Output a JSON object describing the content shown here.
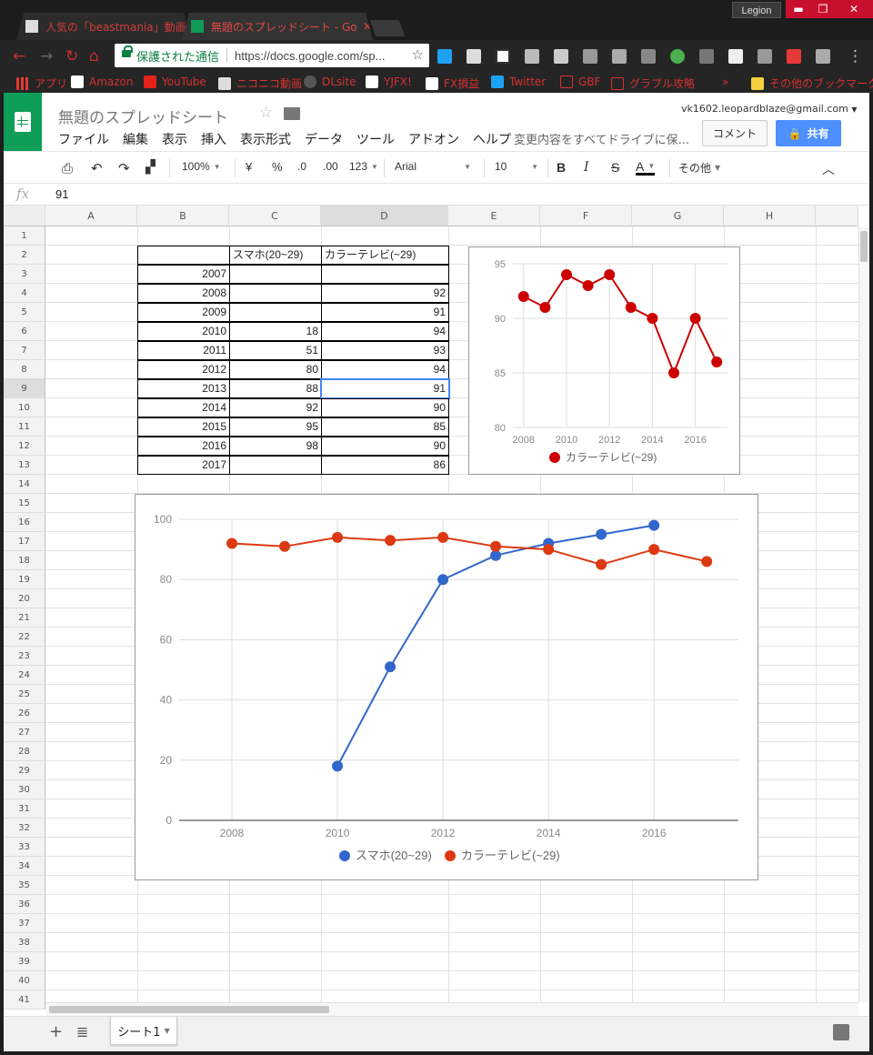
{
  "browser": {
    "profile": "Legion",
    "tabs": [
      {
        "label": "人気の「beastmania」動画",
        "close": "×"
      },
      {
        "label": "無題のスプレッドシート - Go",
        "close": "×"
      }
    ],
    "address": {
      "secure_label": "保護された通信",
      "url": "https://docs.google.com/sp..."
    },
    "bookmarks": [
      {
        "label": "アプリ"
      },
      {
        "label": "Amazon"
      },
      {
        "label": "YouTube"
      },
      {
        "label": "ニコニコ動画"
      },
      {
        "label": "DLsite"
      },
      {
        "label": "YJFX!"
      },
      {
        "label": "FX損益"
      },
      {
        "label": "Twitter"
      },
      {
        "label": "GBF"
      },
      {
        "label": "グラブル攻略"
      },
      {
        "label": "»"
      },
      {
        "label": "その他のブックマーク"
      }
    ]
  },
  "app": {
    "title": "無題のスプレッドシート",
    "account": "vk1602.leopardblaze@gmail.com",
    "menu": [
      "ファイル",
      "編集",
      "表示",
      "挿入",
      "表示形式",
      "データ",
      "ツール",
      "アドオン",
      "ヘルプ"
    ],
    "save_status": "変更内容をすべてドライブに保...",
    "comment_label": "コメント",
    "share_label": "共有"
  },
  "toolbar": {
    "zoom": "100%",
    "currency": "¥",
    "percent": "%",
    "dec_less": ".0",
    "dec_more": ".00",
    "format_more": "123",
    "font": "Arial",
    "font_size": "10",
    "bold": "B",
    "italic": "I",
    "strike": "S",
    "text_color": "A",
    "more": "その他"
  },
  "formula": {
    "fx": "fx",
    "value": "91"
  },
  "columns": [
    "A",
    "B",
    "C",
    "D",
    "E",
    "F",
    "G",
    "H"
  ],
  "rows": [
    "1",
    "2",
    "3",
    "4",
    "5",
    "6",
    "7",
    "8",
    "9",
    "10",
    "11",
    "12",
    "13",
    "14",
    "15",
    "16",
    "17",
    "18",
    "19",
    "20",
    "21",
    "22",
    "23",
    "24",
    "25",
    "26",
    "27",
    "28",
    "29",
    "30",
    "31",
    "32",
    "33",
    "34",
    "35",
    "36",
    "37",
    "38",
    "39",
    "40",
    "41"
  ],
  "table": {
    "headers": [
      "",
      "スマホ(20~29)",
      "カラーテレビ(~29)"
    ],
    "rows": [
      {
        "year": "2007",
        "phone": "",
        "tv": ""
      },
      {
        "year": "2008",
        "phone": "",
        "tv": "92"
      },
      {
        "year": "2009",
        "phone": "",
        "tv": "91"
      },
      {
        "year": "2010",
        "phone": "18",
        "tv": "94"
      },
      {
        "year": "2011",
        "phone": "51",
        "tv": "93"
      },
      {
        "year": "2012",
        "phone": "80",
        "tv": "94"
      },
      {
        "year": "2013",
        "phone": "88",
        "tv": "91"
      },
      {
        "year": "2014",
        "phone": "92",
        "tv": "90"
      },
      {
        "year": "2015",
        "phone": "95",
        "tv": "85"
      },
      {
        "year": "2016",
        "phone": "98",
        "tv": "90"
      },
      {
        "year": "2017",
        "phone": "",
        "tv": "86"
      }
    ]
  },
  "sheet": {
    "name": "シート1"
  },
  "chart_data": [
    {
      "type": "line",
      "x": [
        2008,
        2009,
        2010,
        2011,
        2012,
        2013,
        2014,
        2015,
        2016,
        2017
      ],
      "series": [
        {
          "name": "カラーテレビ(~29)",
          "color": "#cc0000",
          "values": [
            92,
            91,
            94,
            93,
            94,
            91,
            90,
            85,
            90,
            86
          ]
        }
      ],
      "xticks": [
        "2008",
        "2010",
        "2012",
        "2014",
        "2016"
      ],
      "yticks": [
        "80",
        "85",
        "90",
        "95"
      ],
      "xlim": [
        2007.5,
        2017.5
      ],
      "ylim": [
        80,
        95
      ],
      "legend": "bottom",
      "grid": true
    },
    {
      "type": "line",
      "x": [
        2008,
        2009,
        2010,
        2011,
        2012,
        2013,
        2014,
        2015,
        2016,
        2017
      ],
      "series": [
        {
          "name": "スマホ(20~29)",
          "color": "#3366cc",
          "values": [
            null,
            null,
            18,
            51,
            80,
            88,
            92,
            95,
            98,
            null
          ]
        },
        {
          "name": "カラーテレビ(~29)",
          "color": "#dc3912",
          "values": [
            92,
            91,
            94,
            93,
            94,
            91,
            90,
            85,
            90,
            86
          ]
        }
      ],
      "xticks": [
        "2008",
        "2010",
        "2012",
        "2014",
        "2016"
      ],
      "yticks": [
        "0",
        "20",
        "40",
        "60",
        "80",
        "100"
      ],
      "xlim": [
        2007,
        2017.6
      ],
      "ylim": [
        0,
        100
      ],
      "legend": "bottom",
      "grid": true
    }
  ]
}
